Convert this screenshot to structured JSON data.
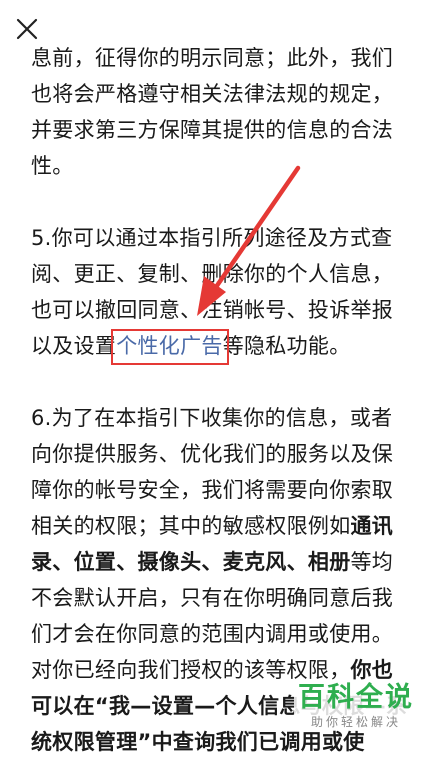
{
  "header": {
    "close_icon": "close-icon"
  },
  "paragraphs": {
    "p1": "息前，征得你的明示同意；此外，我们也将会严格遵守相关法律法规的规定，并要求第三方保障其提供的信息的合法性。",
    "p2_before": "5.你可以通过本指引所列途径及方式查阅、更正、复制、删除你的个人信息，也可以撤回同意、注销帐号、投诉举报以及设置",
    "p2_link": "个性化广告",
    "p2_after": "等隐私功能。",
    "p3_part1": "6.为了在本指引下收集你的信息，或者向你提供服务、优化我们的服务以及保障你的帐号安全，我们将需要向你索取相关的权限；其中的敏感权限例如",
    "p3_bold1": "通讯录、位置、摄像头、麦克风、相册",
    "p3_part2": "等均不会默认开启，只有在你明确同意后我们才会在你同意的范围内调用或使用。对你已经向我们授权的该等权限，",
    "p3_bold2": "你也可以在“我—设置—个人信息与权限—系统权限管理”中查询我们已调用或使",
    "p3_part3": ""
  },
  "colors": {
    "link": "#4a6aa8",
    "highlight_box": "#e53935",
    "arrow": "#e53935",
    "watermark": "#2fae4f"
  },
  "watermark": {
    "main": "百科全说",
    "sub": "助你轻松解决"
  }
}
